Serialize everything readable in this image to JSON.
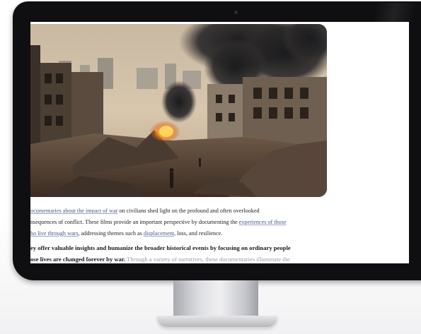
{
  "article": {
    "hero_image_alt": "war-damaged city with burning buildings",
    "paragraph1": {
      "line1": {
        "link": "ocumentaries about the impact of war",
        "text": " on civilians shed light on the profound and often overlooked"
      },
      "line2": {
        "text": "nsequences of conflict. These films provide an important perspective by documenting the ",
        "link": "experiences of those"
      },
      "line3": {
        "link": "ho live through wars",
        "text1": ", addressing themes such as ",
        "link2": "displacement",
        "text2": ", loss, and resilience."
      }
    },
    "paragraph2": {
      "line1": {
        "text": "ey offer valuable insights and humanize the broader historical events by focusing on ordinary people"
      },
      "line2": {
        "strong": "ose lives are changed forever by war.",
        "text": " Through a variety of narratives, these documentaries illuminate the"
      }
    }
  },
  "colors": {
    "link": "#4a5784",
    "bezel": "#0f0f11",
    "text": "#232323"
  }
}
